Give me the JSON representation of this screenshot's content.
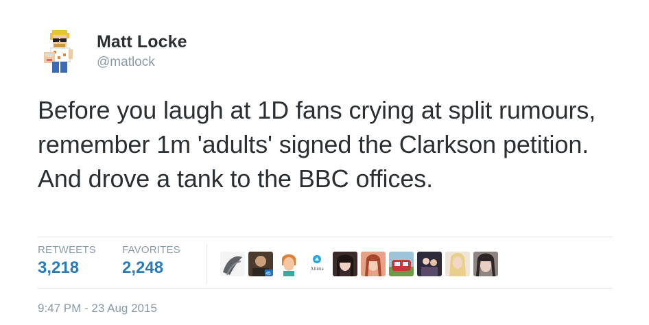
{
  "author": {
    "name": "Matt Locke",
    "handle": "@matlock",
    "avatar_icon": "pixel-art-avatar-icon"
  },
  "tweet": {
    "text": "Before you laugh at 1D fans crying at split rumours, remember 1m 'adults' signed the Clarkson petition. And drove a tank to the BBC offices."
  },
  "stats": {
    "retweets_label": "RETWEETS",
    "retweets_value": "3,218",
    "favorites_label": "FAVORITES",
    "favorites_value": "2,248"
  },
  "favoriters": [
    {
      "icon": "user-avatar-icon",
      "color": "#6b6f73",
      "badge": ""
    },
    {
      "icon": "user-avatar-icon",
      "color": "#4a3b2e",
      "badge": "45"
    },
    {
      "icon": "user-avatar-icon",
      "color": "#d98b4a",
      "badge": ""
    },
    {
      "icon": "altima-logo-icon",
      "color": "#ffffff",
      "badge": "Altima"
    },
    {
      "icon": "user-avatar-icon",
      "color": "#3a2a2a",
      "badge": ""
    },
    {
      "icon": "user-avatar-icon",
      "color": "#c46a52",
      "badge": ""
    },
    {
      "icon": "user-avatar-icon",
      "color": "#b23a3a",
      "badge": ""
    },
    {
      "icon": "user-avatar-icon",
      "color": "#2d2a3a",
      "badge": ""
    },
    {
      "icon": "user-avatar-icon",
      "color": "#d9c2a8",
      "badge": ""
    },
    {
      "icon": "user-avatar-icon",
      "color": "#7a6e6a",
      "badge": ""
    }
  ],
  "timestamp": "9:47 PM - 23 Aug 2015",
  "colors": {
    "link": "#2b7bb9",
    "muted": "#8899a6",
    "text": "#292f33",
    "divider": "#e1e8ed"
  }
}
